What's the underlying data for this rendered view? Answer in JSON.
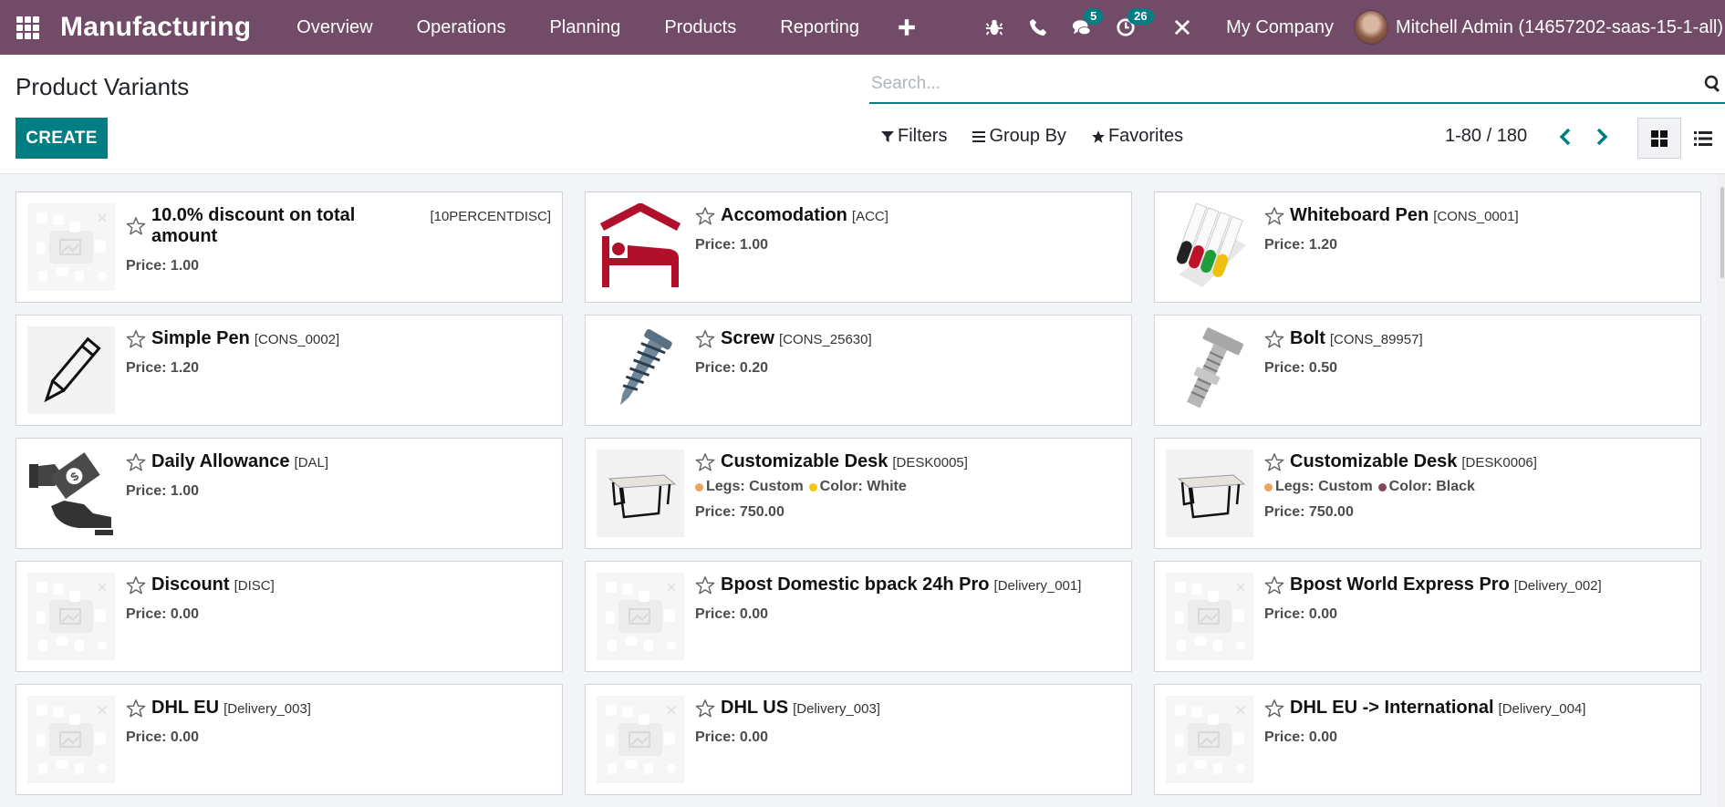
{
  "navbar": {
    "app_name": "Manufacturing",
    "menu": [
      "Overview",
      "Operations",
      "Planning",
      "Products",
      "Reporting"
    ],
    "icons": [
      "plus-icon",
      "bug-icon",
      "phone-icon",
      "chat-icon",
      "clock-icon",
      "tools-icon"
    ],
    "messages_count": "5",
    "activities_count": "26",
    "company": "My Company",
    "user": "Mitchell Admin (14657202-saas-15-1-all)"
  },
  "control_panel": {
    "title": "Product Variants",
    "create_label": "CREATE",
    "search_placeholder": "Search...",
    "filters_label": "Filters",
    "groupby_label": "Group By",
    "favorites_label": "Favorites",
    "pager_value": "1-80 / 180",
    "views": [
      "kanban",
      "list"
    ],
    "active_view": "kanban"
  },
  "colors": {
    "brand": "#714b67",
    "accent": "#017e84"
  },
  "products": [
    {
      "name": "10.0% discount on total amount",
      "ref": "[10PERCENTDISC]",
      "price": "Price: 1.00",
      "image": "placeholder",
      "attributes": []
    },
    {
      "name": "Accomodation",
      "ref": "[ACC]",
      "price": "Price: 1.00",
      "image": "bed",
      "attributes": []
    },
    {
      "name": "Whiteboard Pen",
      "ref": "[CONS_0001]",
      "price": "Price: 1.20",
      "image": "markers",
      "attributes": []
    },
    {
      "name": "Simple Pen",
      "ref": "[CONS_0002]",
      "price": "Price: 1.20",
      "image": "pencil",
      "attributes": []
    },
    {
      "name": "Screw",
      "ref": "[CONS_25630]",
      "price": "Price: 0.20",
      "image": "screw",
      "attributes": []
    },
    {
      "name": "Bolt",
      "ref": "[CONS_89957]",
      "price": "Price: 0.50",
      "image": "bolt",
      "attributes": []
    },
    {
      "name": "Daily Allowance",
      "ref": "[DAL]",
      "price": "Price: 1.00",
      "image": "money",
      "attributes": []
    },
    {
      "name": "Customizable Desk",
      "ref": "[DESK0005]",
      "price": "Price: 750.00",
      "image": "desk",
      "attributes": [
        {
          "label": "Legs: Custom",
          "color": "#e9a55e"
        },
        {
          "label": "Color: White",
          "color": "#f5c518"
        }
      ]
    },
    {
      "name": "Customizable Desk",
      "ref": "[DESK0006]",
      "price": "Price: 750.00",
      "image": "desk",
      "attributes": [
        {
          "label": "Legs: Custom",
          "color": "#e9a55e"
        },
        {
          "label": "Color: Black",
          "color": "#7f4a5f"
        }
      ]
    },
    {
      "name": "Discount",
      "ref": "[DISC]",
      "price": "Price: 0.00",
      "image": "placeholder",
      "attributes": []
    },
    {
      "name": "Bpost Domestic bpack 24h Pro",
      "ref": "[Delivery_001]",
      "price": "Price: 0.00",
      "image": "placeholder",
      "attributes": []
    },
    {
      "name": "Bpost World Express Pro",
      "ref": "[Delivery_002]",
      "price": "Price: 0.00",
      "image": "placeholder",
      "attributes": []
    },
    {
      "name": "DHL EU",
      "ref": "[Delivery_003]",
      "price": "Price: 0.00",
      "image": "placeholder",
      "attributes": []
    },
    {
      "name": "DHL US",
      "ref": "[Delivery_003]",
      "price": "Price: 0.00",
      "image": "placeholder",
      "attributes": []
    },
    {
      "name": "DHL EU -> International",
      "ref": "[Delivery_004]",
      "price": "Price: 0.00",
      "image": "placeholder",
      "attributes": []
    }
  ]
}
